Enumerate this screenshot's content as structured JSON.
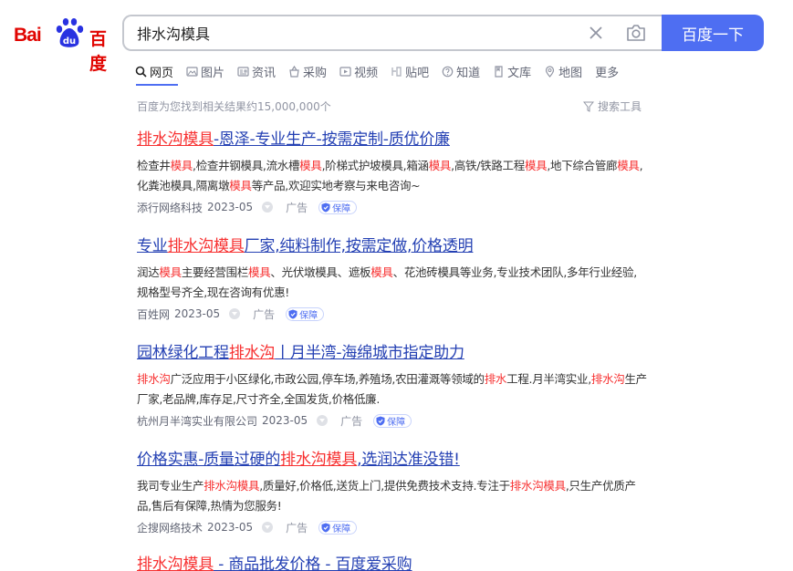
{
  "logo": {
    "text_left": "Bai",
    "text_paw": "du",
    "text_right": "百度"
  },
  "search": {
    "query": "排水沟模具",
    "button_label": "百度一下"
  },
  "tabs": [
    {
      "label": "网页",
      "icon": "search-icon"
    },
    {
      "label": "图片",
      "icon": "image-icon"
    },
    {
      "label": "资讯",
      "icon": "news-icon"
    },
    {
      "label": "采购",
      "icon": "basket-icon"
    },
    {
      "label": "视频",
      "icon": "video-icon"
    },
    {
      "label": "贴吧",
      "icon": "tieba-icon"
    },
    {
      "label": "知道",
      "icon": "question-icon"
    },
    {
      "label": "文库",
      "icon": "document-icon"
    },
    {
      "label": "地图",
      "icon": "map-icon"
    },
    {
      "label": "更多",
      "icon": ""
    }
  ],
  "stats": {
    "text": "百度为您找到相关结果约15,000,000个",
    "tools_label": "搜索工具"
  },
  "results": [
    {
      "title": [
        {
          "t": "排水沟模具",
          "h": true
        },
        {
          "t": "-恩泽-专业生产-按需定制-质优价廉",
          "h": false
        }
      ],
      "desc": [
        {
          "t": "检查井",
          "h": false
        },
        {
          "t": "模具",
          "h": true
        },
        {
          "t": ",检查井钢模具,流水槽",
          "h": false
        },
        {
          "t": "模具",
          "h": true
        },
        {
          "t": ",阶梯式护坡模具,箱涵",
          "h": false
        },
        {
          "t": "模具",
          "h": true
        },
        {
          "t": ",高铁/铁路工程",
          "h": false
        },
        {
          "t": "模具",
          "h": true
        },
        {
          "t": ",地下综合管廊",
          "h": false
        },
        {
          "t": "模具",
          "h": true
        },
        {
          "t": ",化粪池模具,隔离墩",
          "h": false
        },
        {
          "t": "模具",
          "h": true
        },
        {
          "t": "等产品,欢迎实地考察与来电咨询~",
          "h": false
        }
      ],
      "source": "添行网络科技",
      "date": "2023-05",
      "ad_label": "广告",
      "badge": "保障"
    },
    {
      "title": [
        {
          "t": "专业",
          "h": false
        },
        {
          "t": "排水沟模具",
          "h": true
        },
        {
          "t": "厂家,纯料制作,按需定做,价格透明",
          "h": false
        }
      ],
      "desc": [
        {
          "t": "润达",
          "h": false
        },
        {
          "t": "模具",
          "h": true
        },
        {
          "t": "主要经营围栏",
          "h": false
        },
        {
          "t": "模具",
          "h": true
        },
        {
          "t": "、光伏墩模具、遮板",
          "h": false
        },
        {
          "t": "模具",
          "h": true
        },
        {
          "t": "、花池砖模具等业务,专业技术团队,多年行业经验,规格型号齐全,现在咨询有优惠!",
          "h": false
        }
      ],
      "source": "百姓网",
      "date": "2023-05",
      "ad_label": "广告",
      "badge": "保障"
    },
    {
      "title": [
        {
          "t": "园林绿化工程",
          "h": false
        },
        {
          "t": "排水沟",
          "h": true
        },
        {
          "t": "丨月半湾-海绵城市指定助力",
          "h": false
        }
      ],
      "desc": [
        {
          "t": "排水沟",
          "h": true
        },
        {
          "t": "广泛应用于小区绿化,市政公园,停车场,养殖场,农田灌溉等领域的",
          "h": false
        },
        {
          "t": "排水",
          "h": true
        },
        {
          "t": "工程.月半湾实业,",
          "h": false
        },
        {
          "t": "排水沟",
          "h": true
        },
        {
          "t": "生产厂家,老品牌,库存足,尺寸齐全,全国发货,价格低廉.",
          "h": false
        }
      ],
      "source": "杭州月半湾实业有限公司",
      "date": "2023-05",
      "ad_label": "广告",
      "badge": "保障"
    },
    {
      "title": [
        {
          "t": "价格实惠-质量过硬的",
          "h": false
        },
        {
          "t": "排水沟模具",
          "h": true
        },
        {
          "t": ",选润达准没错!",
          "h": false
        }
      ],
      "desc": [
        {
          "t": "我司专业生产",
          "h": false
        },
        {
          "t": "排水沟模具",
          "h": true
        },
        {
          "t": ",质量好,价格低,送货上门,提供免费技术支持.专注于",
          "h": false
        },
        {
          "t": "排水沟模具",
          "h": true
        },
        {
          "t": ",只生产优质产品,售后有保障,热情为您服务!",
          "h": false
        }
      ],
      "source": "企搜网络技术",
      "date": "2023-05",
      "ad_label": "广告",
      "badge": "保障"
    },
    {
      "title": [
        {
          "t": "排水沟模具",
          "h": true
        },
        {
          "t": " - 商品批发价格 - 百度爱采购",
          "h": false
        }
      ],
      "desc": [],
      "source": "",
      "date": "",
      "ad_label": "",
      "badge": ""
    }
  ],
  "colors": {
    "brand_blue": "#4e6ef2",
    "link_blue": "#2440b3",
    "highlight_red": "#f73131",
    "logo_red": "#e10602"
  }
}
